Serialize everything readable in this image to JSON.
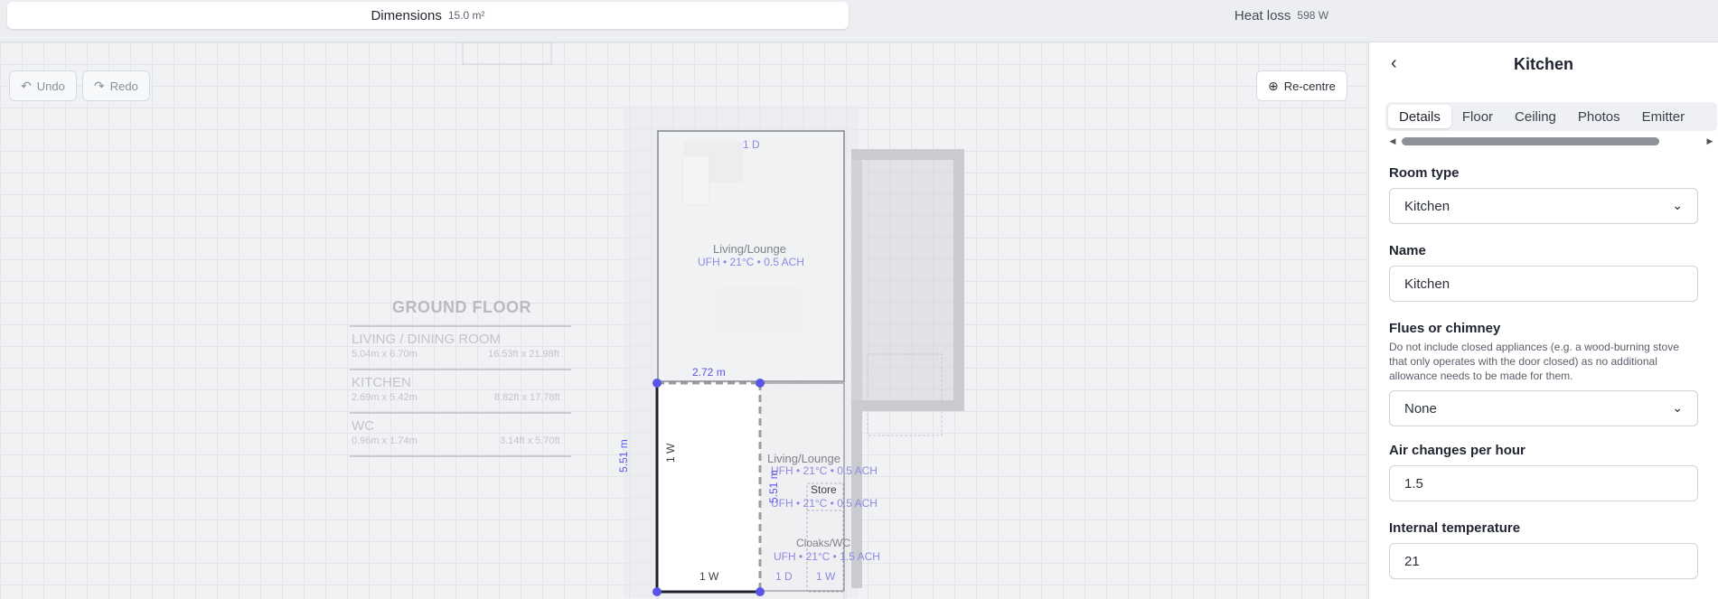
{
  "summary": {
    "dimensions_label": "Dimensions",
    "dimensions_value": "15.0 m²",
    "heatloss_label": "Heat loss",
    "heatloss_value": "598 W"
  },
  "toolbar": {
    "undo_label": "Undo",
    "redo_label": "Redo",
    "recentre_label": "Re-centre"
  },
  "plan": {
    "floorplan_title": "GROUND FLOOR",
    "legend": [
      {
        "name": "LIVING / DINING ROOM",
        "metric": "5.04m x 6.70m",
        "imperial": "16.53ft x 21.98ft"
      },
      {
        "name": "KITCHEN",
        "metric": "2.69m x 5.42m",
        "imperial": "8.82ft x 17.78ft"
      },
      {
        "name": "WC",
        "metric": "0.96m x 1.74m",
        "imperial": "3.14ft x 5.70ft"
      }
    ],
    "rooms": [
      {
        "name": "Living/Lounge",
        "info": "UFH • 21°C • 0.5 ACH"
      },
      {
        "name": "Living/Lounge",
        "info": "UFH • 21°C • 0.5 ACH"
      },
      {
        "name": "Store",
        "info": "UFH • 21°C • 0.5 ACH"
      },
      {
        "name": "Cloaks/WC",
        "info": "UFH • 21°C • 1.5 ACH"
      }
    ],
    "labels": {
      "door_top": "1 D",
      "width_dim": "2.72 m",
      "height_dim": "5.51 m",
      "height_dim_inner": "5.51 m",
      "wall_left": "1 W",
      "wall_bottom": "1 W",
      "door_bottom": "1 D",
      "wall_store": "1 W"
    }
  },
  "panel": {
    "title": "Kitchen",
    "tabs": [
      "Details",
      "Floor",
      "Ceiling",
      "Photos",
      "Emitter"
    ],
    "room_type_label": "Room type",
    "room_type_value": "Kitchen",
    "name_label": "Name",
    "name_value": "Kitchen",
    "flues_label": "Flues or chimney",
    "flues_help": "Do not include closed appliances (e.g. a wood-burning stove that only operates with the door closed) as no additional allowance needs to be made for them.",
    "flues_value": "None",
    "ach_label": "Air changes per hour",
    "ach_value": "1.5",
    "temp_label": "Internal temperature",
    "temp_value": "21"
  },
  "colors": {
    "accent": "#5a55e6",
    "room_text": "#6f6bd8"
  }
}
